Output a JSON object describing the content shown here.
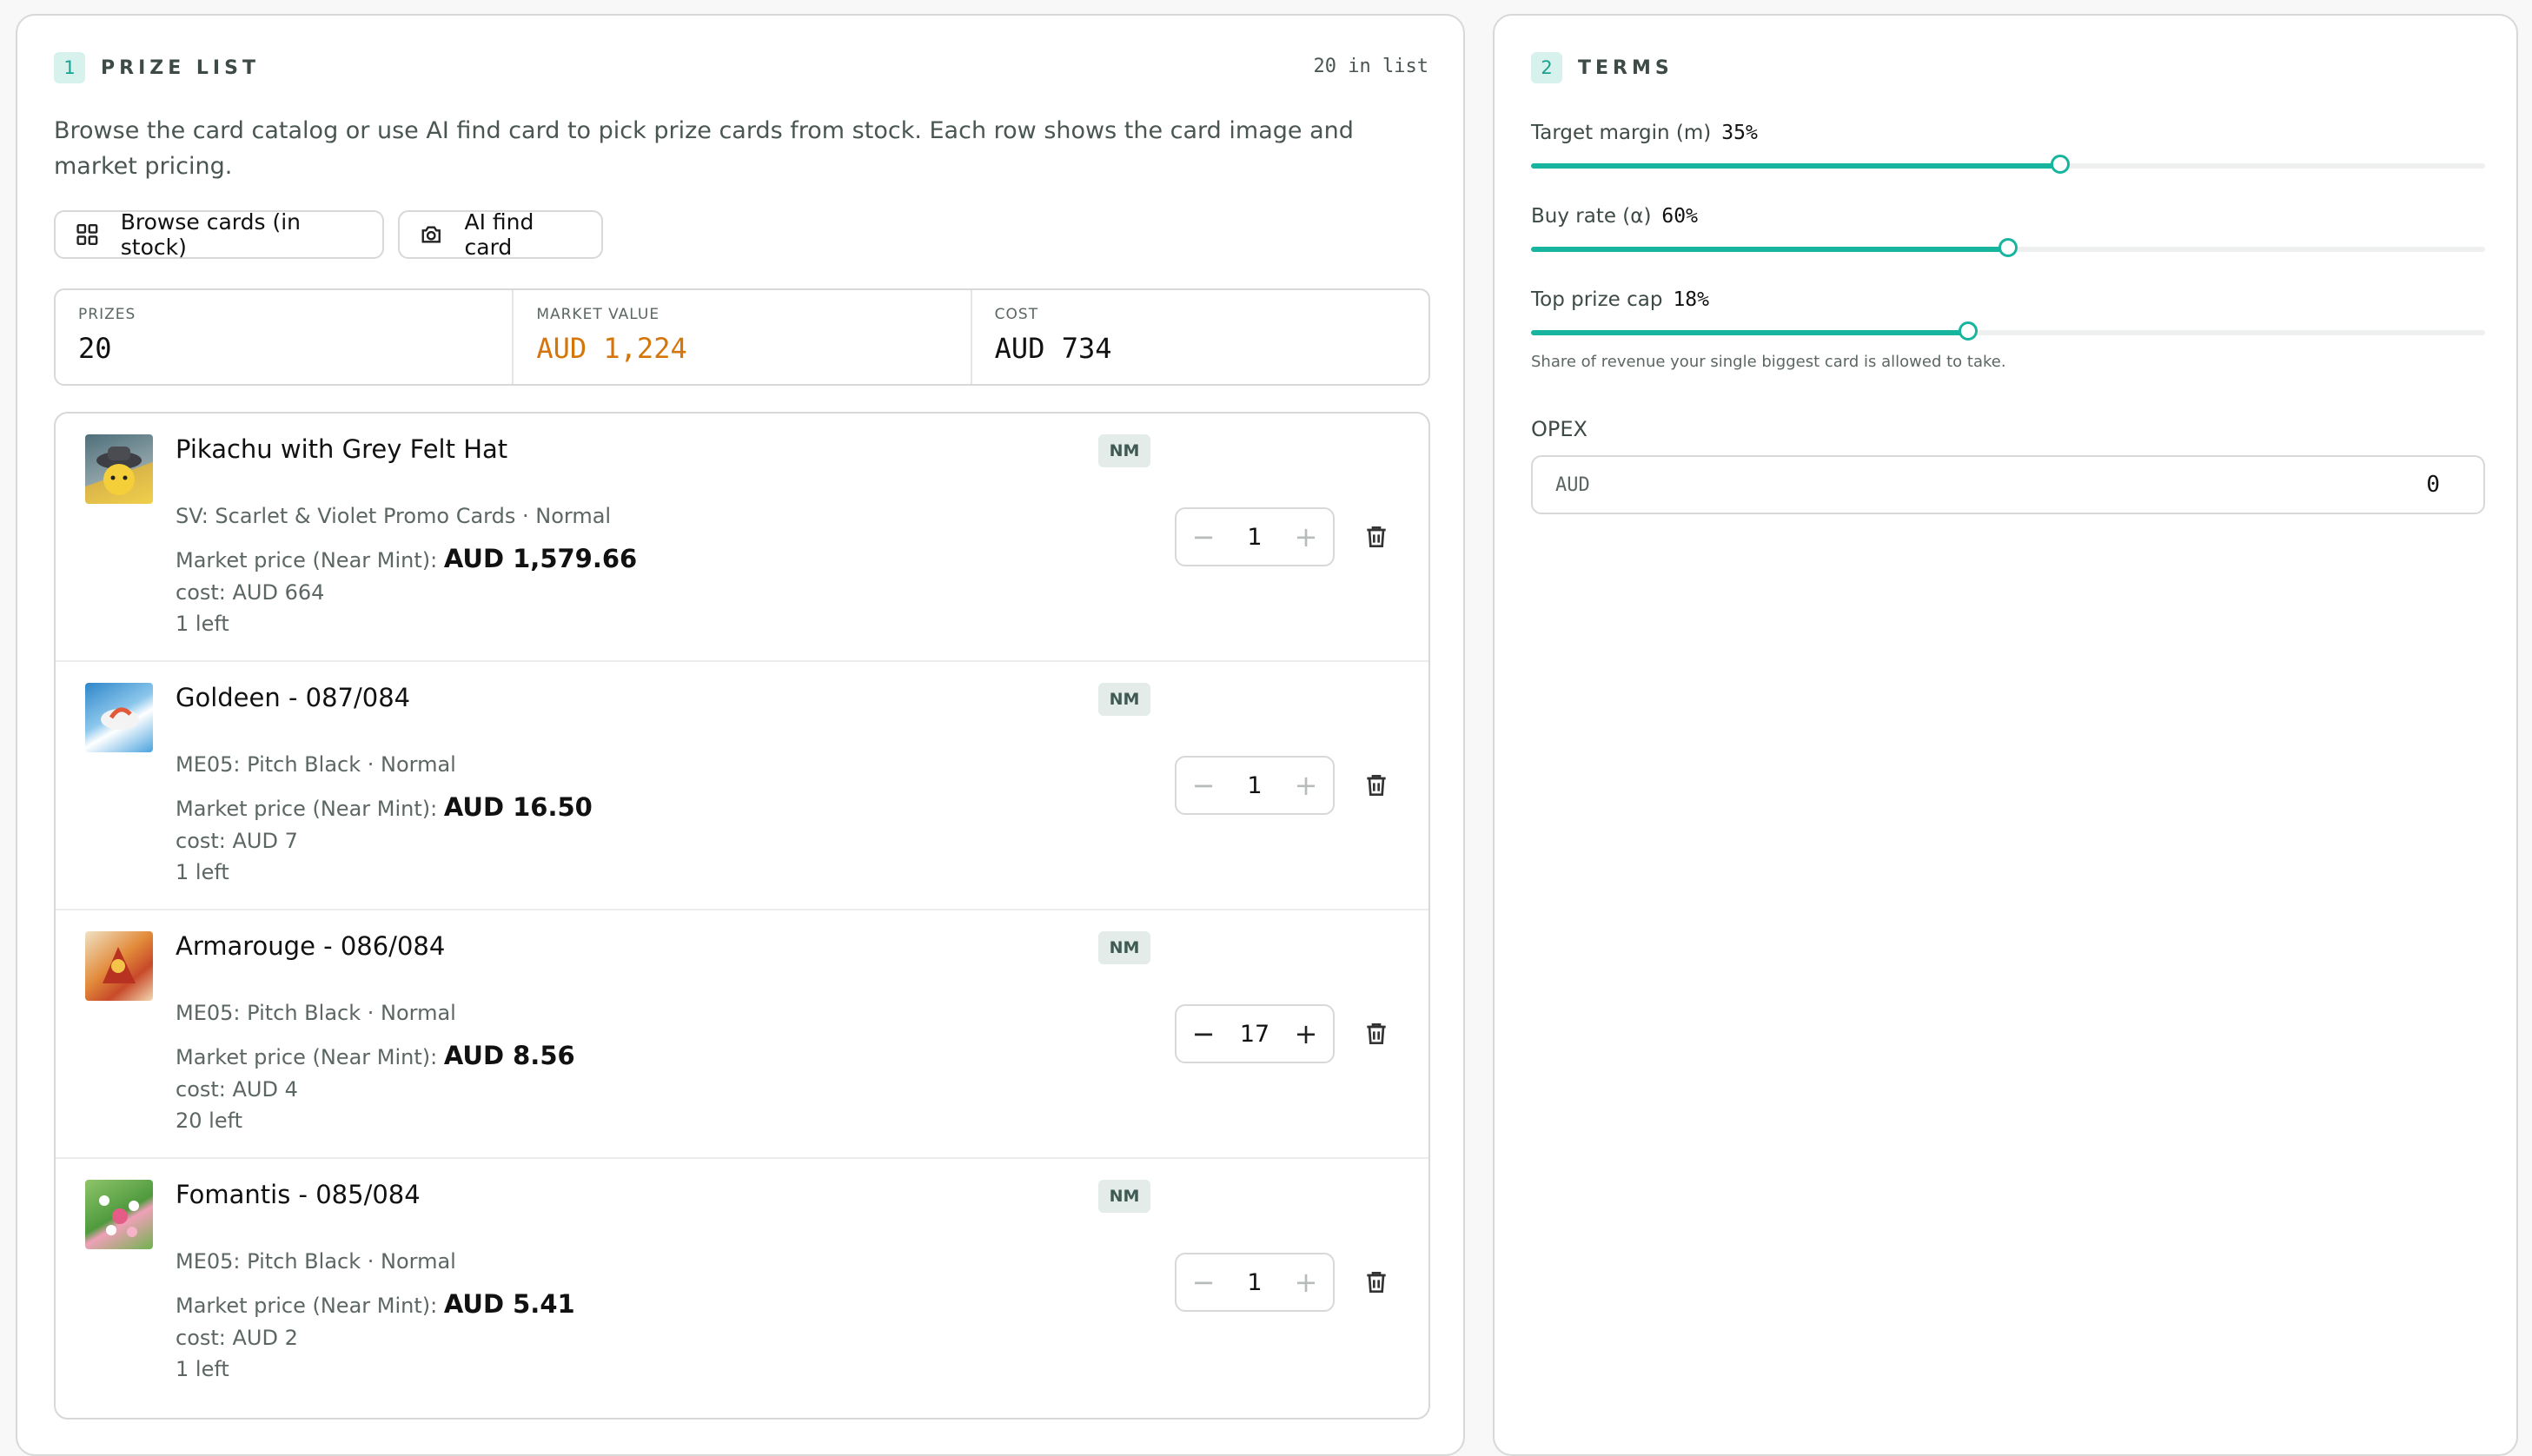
{
  "prize_list": {
    "step": "1",
    "title": "PRIZE LIST",
    "count_label": "20 in list",
    "description": "Browse the card catalog or use AI find card to pick prize cards from stock. Each row shows the card image and market pricing.",
    "browse_button": "Browse cards (in stock)",
    "ai_button": "AI find card",
    "stats": [
      {
        "label": "PRIZES",
        "value": "20"
      },
      {
        "label": "MARKET VALUE",
        "value": "AUD 1,224"
      },
      {
        "label": "COST",
        "value": "AUD 734"
      }
    ],
    "items": [
      {
        "name": "Pikachu with Grey Felt Hat",
        "condition": "NM",
        "set": "SV: Scarlet & Violet Promo Cards · Normal",
        "market_label": "Market price (Near Mint):",
        "market_value": "AUD 1,579.66",
        "cost": "cost: AUD 664",
        "left": "1 left",
        "qty": "1"
      },
      {
        "name": "Goldeen - 087/084",
        "condition": "NM",
        "set": "ME05: Pitch Black · Normal",
        "market_label": "Market price (Near Mint):",
        "market_value": "AUD 16.50",
        "cost": "cost: AUD 7",
        "left": "1 left",
        "qty": "1"
      },
      {
        "name": "Armarouge - 086/084",
        "condition": "NM",
        "set": "ME05: Pitch Black · Normal",
        "market_label": "Market price (Near Mint):",
        "market_value": "AUD 8.56",
        "cost": "cost: AUD 4",
        "left": "20 left",
        "qty": "17"
      },
      {
        "name": "Fomantis - 085/084",
        "condition": "NM",
        "set": "ME05: Pitch Black · Normal",
        "market_label": "Market price (Near Mint):",
        "market_value": "AUD 5.41",
        "cost": "cost: AUD 2",
        "left": "1 left",
        "qty": "1"
      }
    ]
  },
  "terms": {
    "step": "2",
    "title": "TERMS",
    "sliders": [
      {
        "label": "Target margin (m)",
        "value": "35%",
        "level": 0.555
      },
      {
        "label": "Buy rate (α)",
        "value": "60%",
        "level": 0.5
      },
      {
        "label": "Top prize cap",
        "value": "18%",
        "level": 0.458
      }
    ],
    "cap_hint": "Share of revenue your single biggest card is allowed to take.",
    "opex_label": "OPEX",
    "opex_currency": "AUD",
    "opex_value": "0"
  },
  "colors": {
    "accent": "#18b59e",
    "market_value": "#d4760c"
  }
}
